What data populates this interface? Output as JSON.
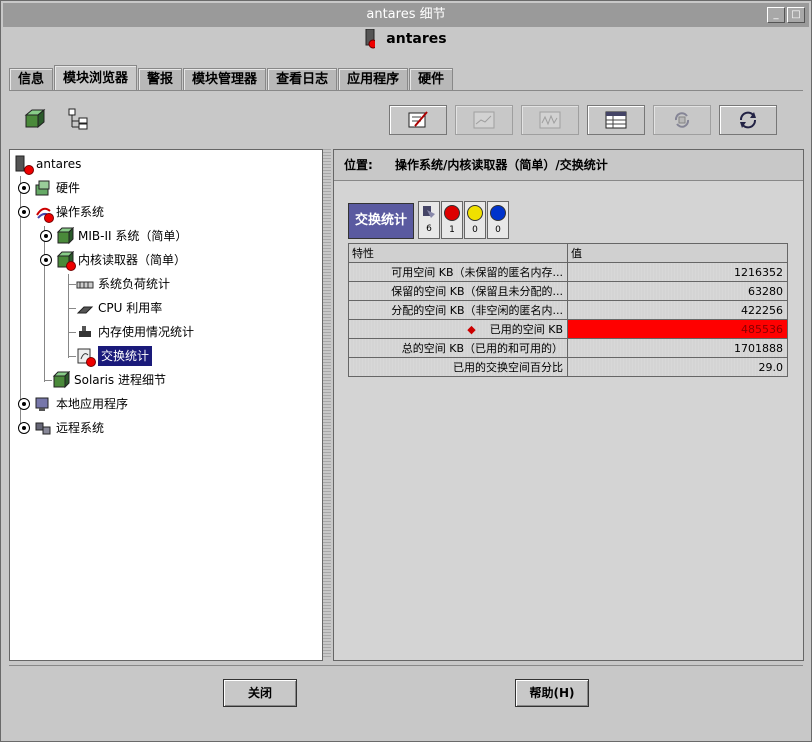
{
  "window": {
    "title": "antares 细节"
  },
  "header": {
    "host": "antares"
  },
  "tabs": [
    "信息",
    "模块浏览器",
    "警报",
    "模块管理器",
    "查看日志",
    "应用程序",
    "硬件"
  ],
  "active_tab": "模块浏览器",
  "tree": {
    "root": "antares",
    "hardware": "硬件",
    "os": "操作系统",
    "mib2": "MIB-II 系统（简单）",
    "kernel": "内核读取器（简单）",
    "load": "系统负荷统计",
    "cpu": "CPU 利用率",
    "mem": "内存使用情况统计",
    "swap": "交换统计",
    "solaris": "Solaris 进程细节",
    "localapp": "本地应用程序",
    "remote": "远程系统"
  },
  "location": {
    "label": "位置:",
    "path": "操作系统/内核读取器（简单）/交换统计"
  },
  "panel": {
    "title": "交换统计",
    "badges": [
      {
        "icon": "info-icon",
        "count": "6"
      },
      {
        "icon": "critical-alarm-icon",
        "count": "1",
        "color": "#dd0000"
      },
      {
        "icon": "warning-icon",
        "count": "0",
        "color": "#f0e000"
      },
      {
        "icon": "minor-icon",
        "count": "0",
        "color": "#0033cc"
      }
    ]
  },
  "table": {
    "headers": [
      "特性",
      "值"
    ],
    "rows": [
      {
        "k": "可用空间 KB（未保留的匿名内存...",
        "v": "1216352"
      },
      {
        "k": "保留的空间 KB（保留且未分配的...",
        "v": "63280"
      },
      {
        "k": "分配的空间 KB（非空闲的匿名内...",
        "v": "422256"
      },
      {
        "k": "已用的空间 KB",
        "v": "485536"
      },
      {
        "k": "总的空间 KB（已用的和可用的）",
        "v": "1701888"
      },
      {
        "k": "已用的交换空间百分比",
        "v": "29.0"
      }
    ]
  },
  "buttons": {
    "close": "关闭",
    "help": "帮助(H)"
  },
  "colors": {
    "alert": "#ff0000",
    "selection": "#1a1a7a",
    "title_bar": "#9a9a9a"
  }
}
